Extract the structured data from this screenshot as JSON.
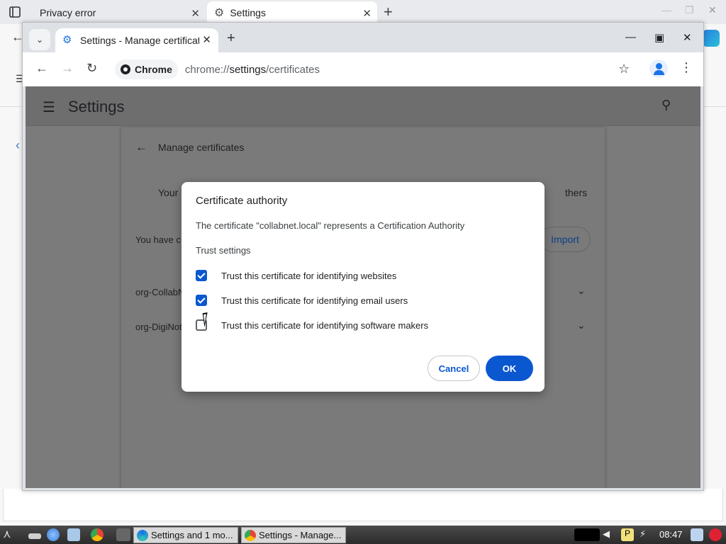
{
  "edge": {
    "tabs": [
      {
        "label": "Privacy error"
      },
      {
        "label": "Settings"
      }
    ]
  },
  "chrome": {
    "tab": {
      "title": "Settings - Manage certificates"
    },
    "omnibox": {
      "chip": "Chrome",
      "url_scheme": "chrome://",
      "url_host": "settings",
      "url_path": "/certificates"
    }
  },
  "settings": {
    "title": "Settings",
    "page_title": "Manage certificates",
    "fragments": {
      "your": "Your",
      "others": "thers",
      "you_have": "You have c",
      "org1": "org-CollabN",
      "org2": "org-DigiNot"
    },
    "import_label": "Import"
  },
  "dialog": {
    "title": "Certificate authority",
    "description": "The certificate \"collabnet.local\" represents a Certification Authority",
    "subtitle": "Trust settings",
    "options": [
      {
        "label": "Trust this certificate for identifying websites",
        "checked": true
      },
      {
        "label": "Trust this certificate for identifying email users",
        "checked": true
      },
      {
        "label": "Trust this certificate for identifying software makers",
        "checked": false
      }
    ],
    "cancel_label": "Cancel",
    "ok_label": "OK",
    "accent_color": "#0b57d0"
  },
  "taskbar": {
    "tasks": [
      {
        "label": "Settings and 1 mo..."
      },
      {
        "label": "Settings - Manage..."
      }
    ],
    "clock": "08:47"
  }
}
